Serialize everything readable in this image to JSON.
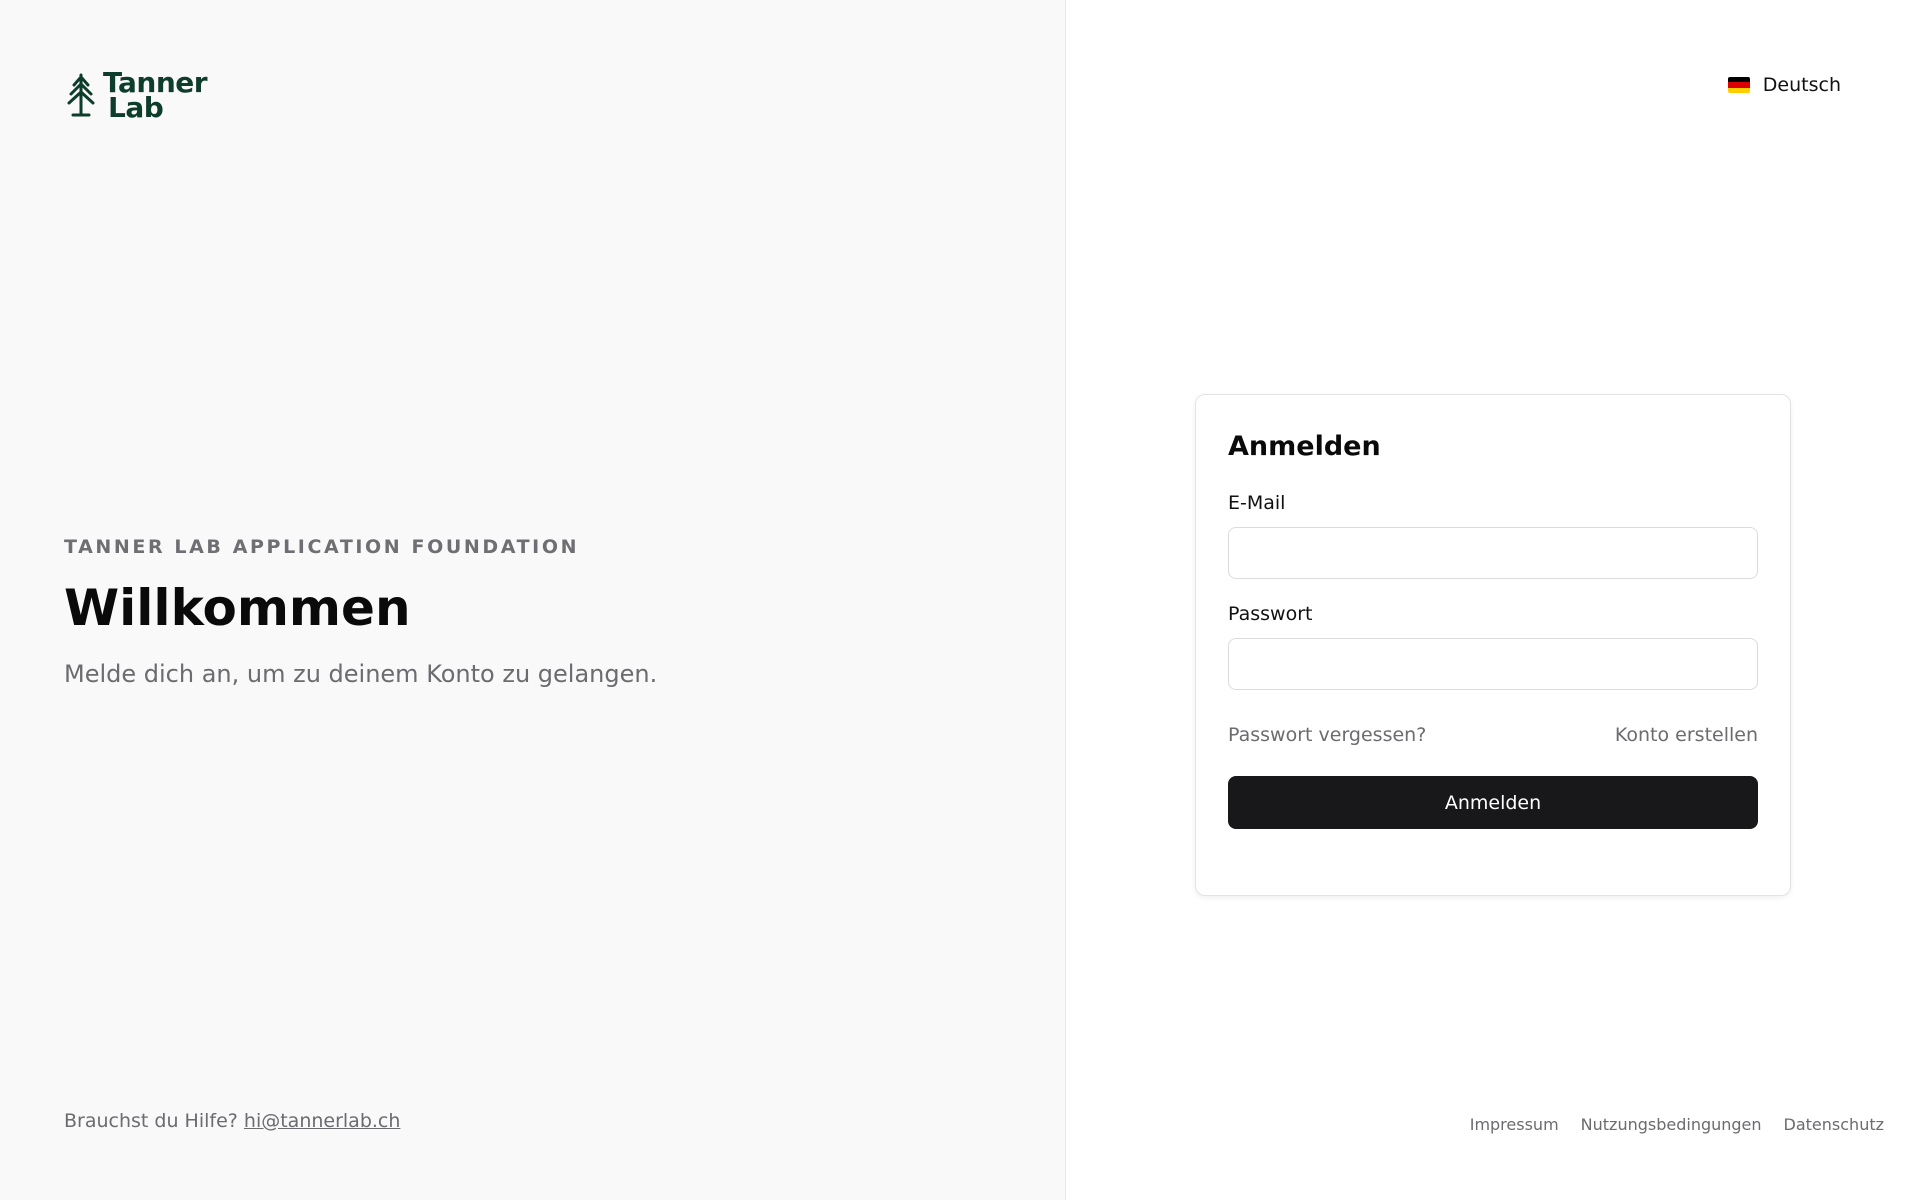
{
  "brand": {
    "line1": "Tanner",
    "line2": "Lab",
    "logo_icon": "tree-icon",
    "color": "#0f3d2c"
  },
  "hero": {
    "eyebrow": "TANNER LAB APPLICATION FOUNDATION",
    "title": "Willkommen",
    "subtitle": "Melde dich an, um zu deinem Konto zu gelangen."
  },
  "help": {
    "text": "Brauchst du Hilfe?",
    "email": "hi@tannerlab.ch"
  },
  "language": {
    "selected": "Deutsch",
    "flag_icon": "german-flag-icon"
  },
  "login": {
    "title": "Anmelden",
    "email_label": "E-Mail",
    "email_value": "",
    "password_label": "Passwort",
    "password_value": "",
    "forgot_link": "Passwort vergessen?",
    "register_link": "Konto erstellen",
    "submit_label": "Anmelden"
  },
  "footer": {
    "links": [
      "Impressum",
      "Nutzungsbedingungen",
      "Datenschutz"
    ]
  },
  "colors": {
    "left_bg": "#f9f9f9",
    "button_bg": "#18181b",
    "muted_text": "#6b6b70"
  }
}
